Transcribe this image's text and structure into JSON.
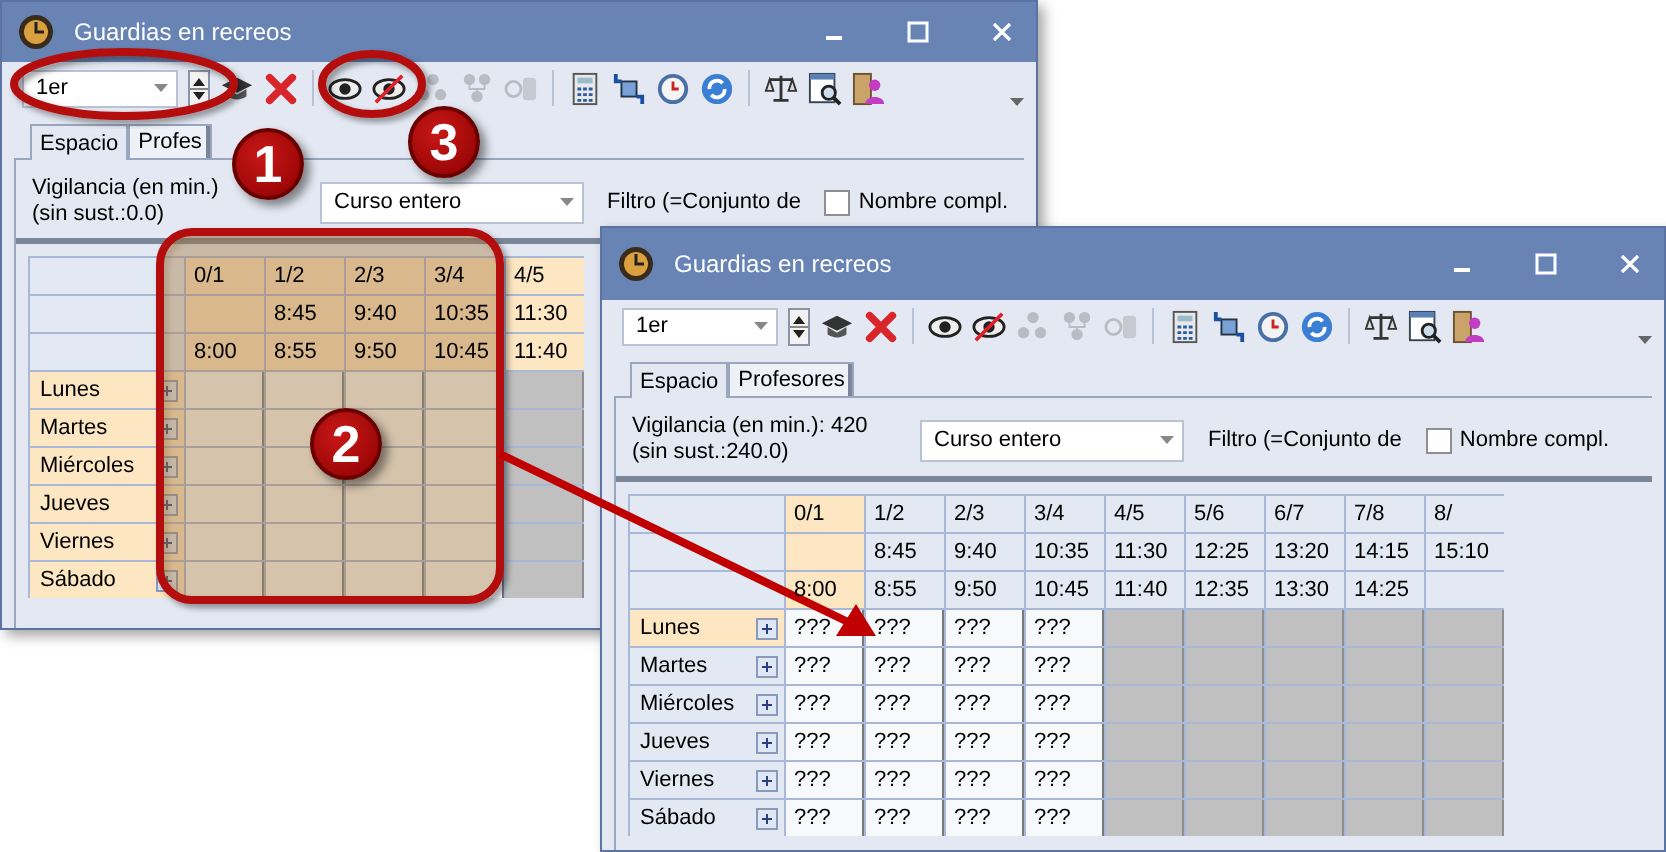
{
  "windows": [
    {
      "title": "Guardias en recreos",
      "period": "1er",
      "tool_groups": [
        [
          {
            "kind": "course",
            "disabled": false
          },
          {
            "kind": "delete",
            "disabled": false
          }
        ],
        [
          {
            "kind": "show",
            "disabled": false
          },
          {
            "kind": "hide",
            "disabled": false
          },
          {
            "kind": "people",
            "disabled": true
          },
          {
            "kind": "tree",
            "disabled": true
          },
          {
            "kind": "coins",
            "disabled": true
          }
        ],
        [
          {
            "kind": "calculator",
            "disabled": false
          },
          {
            "kind": "swap",
            "disabled": false
          },
          {
            "kind": "clock",
            "disabled": false
          },
          {
            "kind": "refresh",
            "disabled": false
          }
        ],
        [
          {
            "kind": "scales",
            "disabled": false
          },
          {
            "kind": "report",
            "disabled": false
          },
          {
            "kind": "person",
            "disabled": false
          }
        ]
      ],
      "tabs": [
        {
          "label": "Espacio",
          "selected": true
        },
        {
          "label": "Profes",
          "selected": false
        }
      ],
      "vigilance": [
        "Vigilancia (en min.)",
        "(sin sust.:0.0)"
      ],
      "course": "Curso entero",
      "filter": "Filtro (=Conjunto de",
      "full_name": {
        "label": "Nombre compl.",
        "checked": false
      },
      "columns": [
        {
          "period": "0/1",
          "end": "8:00",
          "selected": true
        },
        {
          "period": "1/2",
          "start": "8:45",
          "end": "8:55",
          "selected": true
        },
        {
          "period": "2/3",
          "start": "9:40",
          "end": "9:50",
          "selected": true
        },
        {
          "period": "3/4",
          "start": "10:35",
          "end": "10:45",
          "selected": true
        },
        {
          "period": "4/5",
          "start": "11:30",
          "end": "11:40",
          "selected": true
        }
      ],
      "rows": [
        {
          "day": "Lunes",
          "selected": true,
          "cells": [
            {
              "blocked": false
            },
            {
              "blocked": false
            },
            {
              "blocked": false
            },
            {
              "blocked": false
            },
            {
              "blocked": true
            }
          ]
        },
        {
          "day": "Martes",
          "selected": true,
          "cells": [
            {
              "blocked": false
            },
            {
              "blocked": false
            },
            {
              "blocked": false
            },
            {
              "blocked": false
            },
            {
              "blocked": true
            }
          ]
        },
        {
          "day": "Miércoles",
          "selected": true,
          "cells": [
            {
              "blocked": false
            },
            {
              "blocked": false
            },
            {
              "blocked": false
            },
            {
              "blocked": false
            },
            {
              "blocked": true
            }
          ]
        },
        {
          "day": "Jueves",
          "selected": true,
          "cells": [
            {
              "blocked": false
            },
            {
              "blocked": false
            },
            {
              "blocked": false
            },
            {
              "blocked": false
            },
            {
              "blocked": true
            }
          ]
        },
        {
          "day": "Viernes",
          "selected": true,
          "cells": [
            {
              "blocked": false
            },
            {
              "blocked": false
            },
            {
              "blocked": false
            },
            {
              "blocked": false
            },
            {
              "blocked": true
            }
          ]
        },
        {
          "day": "Sábado",
          "selected": true,
          "cells": [
            {
              "blocked": false
            },
            {
              "blocked": false
            },
            {
              "blocked": false
            },
            {
              "blocked": false
            },
            {
              "blocked": true
            }
          ]
        }
      ]
    },
    {
      "title": "Guardias en recreos",
      "period": "1er",
      "tool_groups": [
        [
          {
            "kind": "course",
            "disabled": false
          },
          {
            "kind": "delete",
            "disabled": false
          }
        ],
        [
          {
            "kind": "show",
            "disabled": false
          },
          {
            "kind": "hide",
            "disabled": false
          },
          {
            "kind": "people",
            "disabled": true
          },
          {
            "kind": "tree",
            "disabled": true
          },
          {
            "kind": "coins",
            "disabled": true
          }
        ],
        [
          {
            "kind": "calculator",
            "disabled": false
          },
          {
            "kind": "swap",
            "disabled": false
          },
          {
            "kind": "clock",
            "disabled": false
          },
          {
            "kind": "refresh",
            "disabled": false
          }
        ],
        [
          {
            "kind": "scales",
            "disabled": false
          },
          {
            "kind": "report",
            "disabled": false
          },
          {
            "kind": "person",
            "disabled": false
          }
        ]
      ],
      "tabs": [
        {
          "label": "Espacio",
          "selected": true
        },
        {
          "label": "Profesores",
          "selected": false
        }
      ],
      "vigilance": [
        "Vigilancia (en min.): 420 (sin sust.:240.0)"
      ],
      "course": "Curso entero",
      "filter": "Filtro (=Conjunto de",
      "full_name": {
        "label": "Nombre compl.",
        "checked": false
      },
      "columns": [
        {
          "period": "0/1",
          "end": "8:00",
          "selected": true
        },
        {
          "period": "1/2",
          "start": "8:45",
          "end": "8:55",
          "selected": false
        },
        {
          "period": "2/3",
          "start": "9:40",
          "end": "9:50",
          "selected": false
        },
        {
          "period": "3/4",
          "start": "10:35",
          "end": "10:45",
          "selected": false
        },
        {
          "period": "4/5",
          "start": "11:30",
          "end": "11:40",
          "selected": false
        },
        {
          "period": "5/6",
          "start": "12:25",
          "end": "12:35",
          "selected": false
        },
        {
          "period": "6/7",
          "start": "13:20",
          "end": "13:30",
          "selected": false
        },
        {
          "period": "7/8",
          "start": "14:15",
          "end": "14:25",
          "selected": false
        },
        {
          "period": "8/",
          "start": "15:10",
          "selected": false
        }
      ],
      "rows": [
        {
          "day": "Lunes",
          "selected": true,
          "cells": [
            {
              "text": "???",
              "blocked": false
            },
            {
              "text": "???",
              "blocked": false
            },
            {
              "text": "???",
              "blocked": false
            },
            {
              "text": "???",
              "blocked": false
            },
            {
              "blocked": true
            },
            {
              "blocked": true
            },
            {
              "blocked": true
            },
            {
              "blocked": true
            },
            {
              "blocked": true
            }
          ]
        },
        {
          "day": "Martes",
          "selected": false,
          "cells": [
            {
              "text": "???",
              "blocked": false
            },
            {
              "text": "???",
              "blocked": false
            },
            {
              "text": "???",
              "blocked": false
            },
            {
              "text": "???",
              "blocked": false
            },
            {
              "blocked": true
            },
            {
              "blocked": true
            },
            {
              "blocked": true
            },
            {
              "blocked": true
            },
            {
              "blocked": true
            }
          ]
        },
        {
          "day": "Miércoles",
          "selected": false,
          "cells": [
            {
              "text": "???",
              "blocked": false
            },
            {
              "text": "???",
              "blocked": false
            },
            {
              "text": "???",
              "blocked": false
            },
            {
              "text": "???",
              "blocked": false
            },
            {
              "blocked": true
            },
            {
              "blocked": true
            },
            {
              "blocked": true
            },
            {
              "blocked": true
            },
            {
              "blocked": true
            }
          ]
        },
        {
          "day": "Jueves",
          "selected": false,
          "cells": [
            {
              "text": "???",
              "blocked": false
            },
            {
              "text": "???",
              "blocked": false
            },
            {
              "text": "???",
              "blocked": false
            },
            {
              "text": "???",
              "blocked": false
            },
            {
              "blocked": true
            },
            {
              "blocked": true
            },
            {
              "blocked": true
            },
            {
              "blocked": true
            },
            {
              "blocked": true
            }
          ]
        },
        {
          "day": "Viernes",
          "selected": false,
          "cells": [
            {
              "text": "???",
              "blocked": false
            },
            {
              "text": "???",
              "blocked": false
            },
            {
              "text": "???",
              "blocked": false
            },
            {
              "text": "???",
              "blocked": false
            },
            {
              "blocked": true
            },
            {
              "blocked": true
            },
            {
              "blocked": true
            },
            {
              "blocked": true
            },
            {
              "blocked": true
            }
          ]
        },
        {
          "day": "Sábado",
          "selected": false,
          "cells": [
            {
              "text": "???",
              "blocked": false
            },
            {
              "text": "???",
              "blocked": false
            },
            {
              "text": "???",
              "blocked": false
            },
            {
              "text": "???",
              "blocked": false
            },
            {
              "blocked": true
            },
            {
              "blocked": true
            },
            {
              "blocked": true
            },
            {
              "blocked": true
            },
            {
              "blocked": true
            }
          ]
        }
      ]
    }
  ],
  "callouts": [
    {
      "number": "1"
    },
    {
      "number": "2"
    },
    {
      "number": "3"
    }
  ]
}
